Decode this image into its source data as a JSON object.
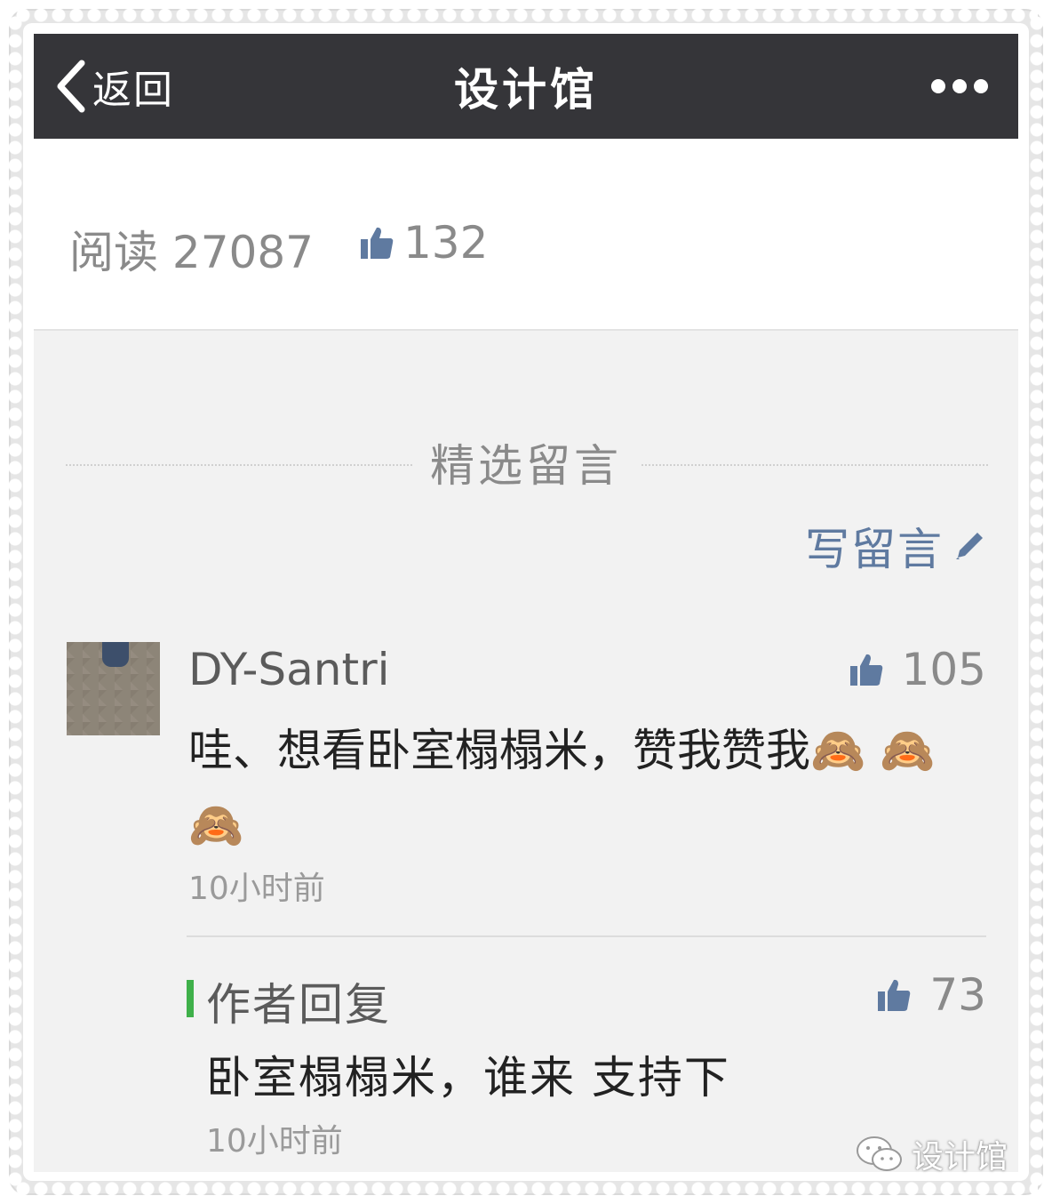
{
  "nav": {
    "back_label": "返回",
    "title": "设计馆"
  },
  "stats": {
    "read_text": "阅读 27087",
    "like_count": "132"
  },
  "comments_section": {
    "title": "精选留言",
    "write_label": "写留言"
  },
  "comment": {
    "author": "DY-Santri",
    "like_count": "105",
    "text": "哇、想看卧室榻榻米，赞我赞我🙈 🙈 🙈",
    "time": "10小时前"
  },
  "reply": {
    "label": "作者回复",
    "like_count": "73",
    "text": "卧室榻榻米，谁来 支持下",
    "time": "10小时前"
  },
  "watermark": {
    "text": "设计馆"
  },
  "colors": {
    "nav_bg": "#353539",
    "link_blue": "#5f7aa0",
    "reply_accent": "#3fb04a",
    "comments_bg": "#f2f2f2"
  },
  "icons": [
    "chevron-left-icon",
    "more-icon",
    "thumbs-up-icon",
    "pencil-icon",
    "wechat-icon"
  ]
}
